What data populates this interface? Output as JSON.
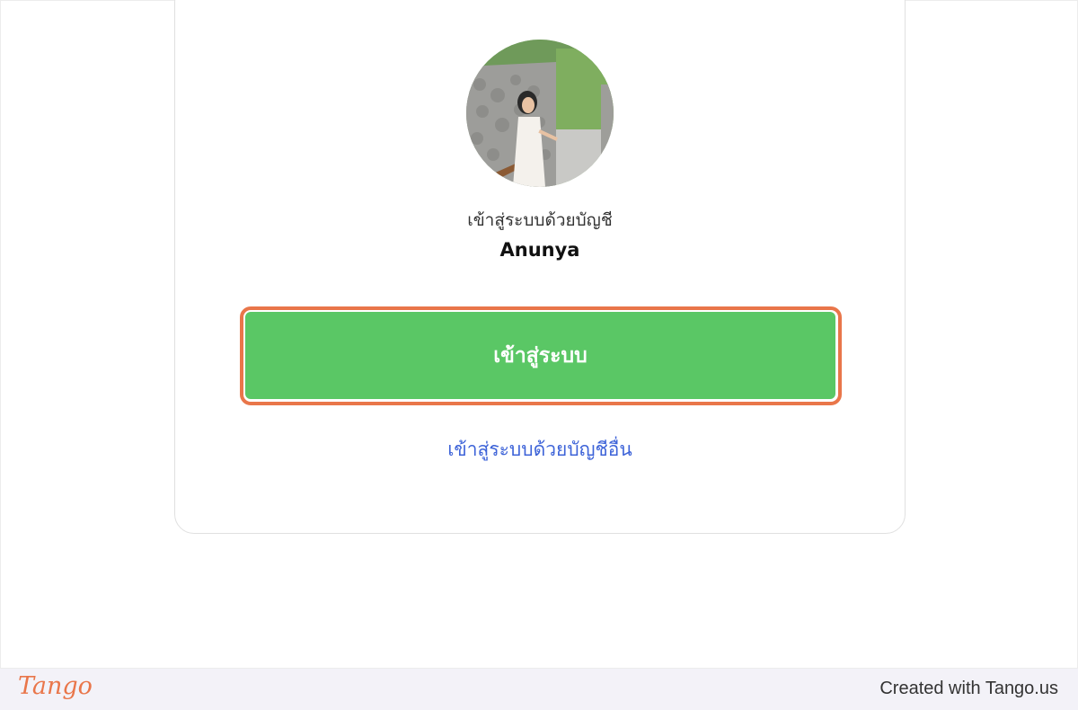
{
  "account": {
    "subtitle": "เข้าสู่ระบบด้วยบัญชี",
    "username": "Anunya"
  },
  "actions": {
    "login_label": "เข้าสู่ระบบ",
    "other_account_label": "เข้าสู่ระบบด้วยบัญชีอื่น"
  },
  "footer": {
    "brand": "Tango",
    "credit": "Created with Tango.us"
  },
  "colors": {
    "login_button": "#5ac765",
    "highlight": "#e9764a",
    "link": "#3d63d8",
    "footer_bg": "#f3f2f8"
  }
}
